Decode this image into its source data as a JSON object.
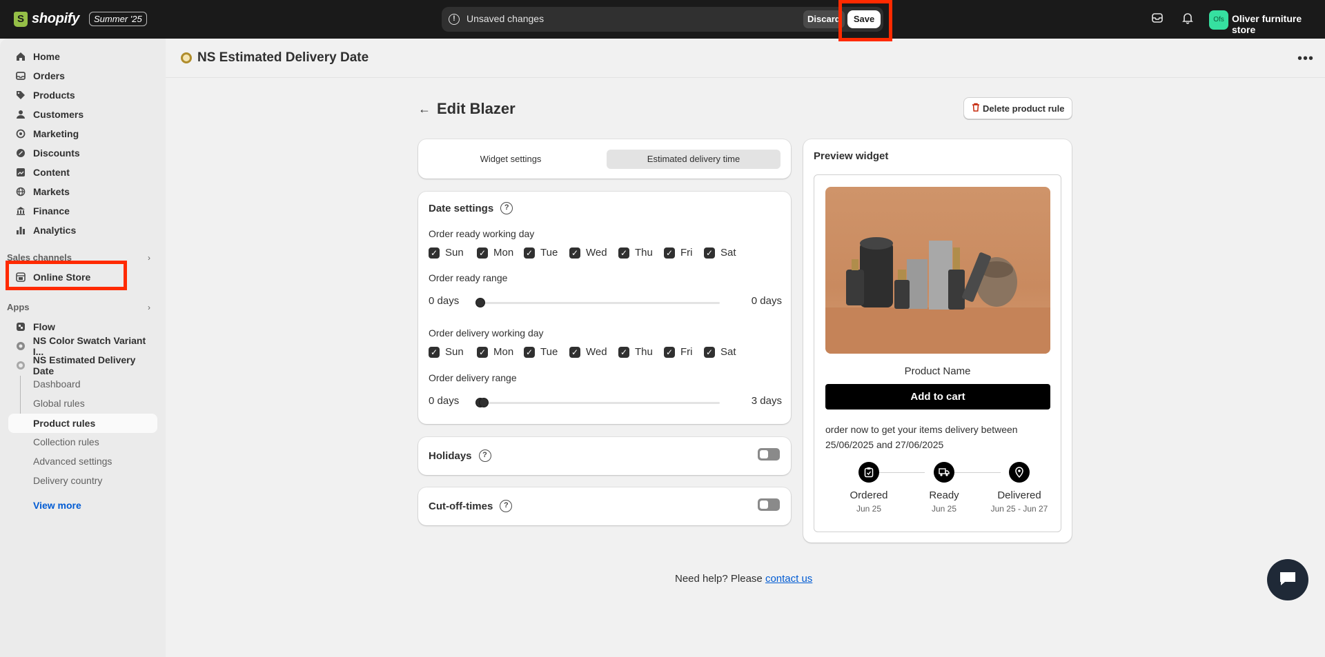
{
  "topbar": {
    "logo_text": "shopify",
    "edition_badge": "Summer '25",
    "unsaved_text": "Unsaved changes",
    "discard_label": "Discard",
    "save_label": "Save",
    "store_initials": "Ofs",
    "store_name": "Oliver furniture store"
  },
  "sidebar": {
    "main_items": [
      {
        "label": "Home",
        "icon": "home-icon"
      },
      {
        "label": "Orders",
        "icon": "orders-icon"
      },
      {
        "label": "Products",
        "icon": "tag-icon"
      },
      {
        "label": "Customers",
        "icon": "person-icon"
      },
      {
        "label": "Marketing",
        "icon": "target-icon"
      },
      {
        "label": "Discounts",
        "icon": "discount-icon"
      },
      {
        "label": "Content",
        "icon": "content-icon"
      },
      {
        "label": "Markets",
        "icon": "globe-icon"
      },
      {
        "label": "Finance",
        "icon": "bank-icon"
      },
      {
        "label": "Analytics",
        "icon": "chart-icon"
      }
    ],
    "sales_channels_title": "Sales channels",
    "online_store_label": "Online Store",
    "apps_title": "Apps",
    "apps": [
      {
        "label": "Flow"
      },
      {
        "label": "NS Color Swatch Variant I..."
      },
      {
        "label": "NS Estimated Delivery Date"
      }
    ],
    "sub_items": [
      "Dashboard",
      "Global rules",
      "Product rules",
      "Collection rules",
      "Advanced settings",
      "Delivery country"
    ],
    "active_sub_item": "Product rules",
    "view_more_label": "View more"
  },
  "app_header": {
    "title": "NS Estimated Delivery Date"
  },
  "page": {
    "title": "Edit Blazer",
    "delete_label": "Delete product rule"
  },
  "tabs": {
    "widget_settings": "Widget settings",
    "estimated_delivery_time": "Estimated delivery time",
    "selected": "Estimated delivery time"
  },
  "date_settings": {
    "title": "Date settings",
    "ready_day_label": "Order ready working day",
    "ready_days": [
      "Sun",
      "Mon",
      "Tue",
      "Wed",
      "Thu",
      "Fri",
      "Sat"
    ],
    "ready_range_label": "Order ready range",
    "ready_range_min": "0 days",
    "ready_range_max": "0 days",
    "ready_range_value": [
      0,
      0
    ],
    "delivery_day_label": "Order delivery working day",
    "delivery_days": [
      "Sun",
      "Mon",
      "Tue",
      "Wed",
      "Thu",
      "Fri",
      "Sat"
    ],
    "delivery_range_label": "Order delivery range",
    "delivery_range_min": "0 days",
    "delivery_range_max": "3 days",
    "delivery_range_value": [
      0,
      0
    ]
  },
  "holidays": {
    "title": "Holidays",
    "enabled": false
  },
  "cutoff": {
    "title": "Cut-off-times",
    "enabled": false
  },
  "preview": {
    "title": "Preview widget",
    "product_name": "Product Name",
    "add_to_cart": "Add to cart",
    "delivery_text": "order now to get your items delivery between 25/06/2025 and 27/06/2025",
    "steps": [
      {
        "label": "Ordered",
        "date": "Jun 25",
        "icon": "clipboard-icon"
      },
      {
        "label": "Ready",
        "date": "Jun 25",
        "icon": "truck-icon"
      },
      {
        "label": "Delivered",
        "date": "Jun 25 - Jun 27",
        "icon": "location-pin-icon"
      }
    ]
  },
  "footer": {
    "help_text": "Need help? Please",
    "contact_label": "contact us"
  },
  "colors": {
    "highlight": "#ff2a00",
    "link": "#005bd3",
    "topbar": "#1a1a1a"
  }
}
